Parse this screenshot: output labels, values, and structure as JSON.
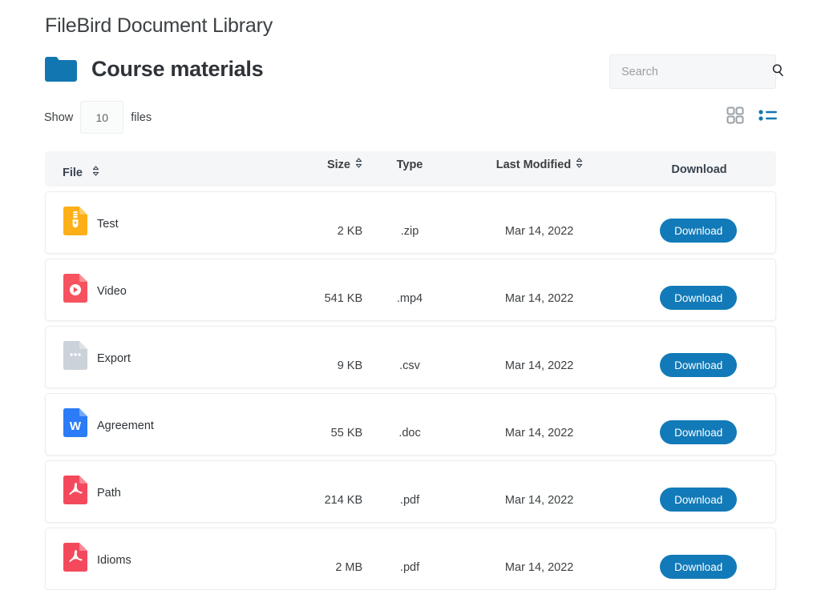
{
  "app": {
    "title": "FileBird Document Library"
  },
  "folder": {
    "icon": "folder-icon",
    "name": "Course materials",
    "color": "#1277b0"
  },
  "search": {
    "placeholder": "Search",
    "value": "",
    "icon": "search-icon"
  },
  "pagination": {
    "show_label": "Show",
    "per_page": "10",
    "files_label": "files"
  },
  "view_toggle": {
    "grid": {
      "icon": "grid-view-icon",
      "active": false,
      "color": "#9aa0a6"
    },
    "list": {
      "icon": "list-view-icon",
      "active": true,
      "color": "#1277b0"
    }
  },
  "table": {
    "columns": [
      {
        "key": "file",
        "label": "File",
        "sortable": true
      },
      {
        "key": "size",
        "label": "Size",
        "sortable": true
      },
      {
        "key": "type",
        "label": "Type",
        "sortable": false
      },
      {
        "key": "date",
        "label": "Last Modified",
        "sortable": true
      },
      {
        "key": "download",
        "label": "Download",
        "sortable": false
      }
    ],
    "rows": [
      {
        "name": "Test",
        "size": "2 KB",
        "type": ".zip",
        "date": "Mar 14, 2022",
        "download_label": "Download",
        "icon": "file-zip-icon",
        "icon_color": "#fcaf17"
      },
      {
        "name": "Video",
        "size": "541 KB",
        "type": ".mp4",
        "date": "Mar 14, 2022",
        "download_label": "Download",
        "icon": "file-video-icon",
        "icon_color": "#f7525f"
      },
      {
        "name": "Export",
        "size": "9 KB",
        "type": ".csv",
        "date": "Mar 14, 2022",
        "download_label": "Download",
        "icon": "file-csv-icon",
        "icon_color": "#cbd2d9"
      },
      {
        "name": "Agreement",
        "size": "55 KB",
        "type": ".doc",
        "date": "Mar 14, 2022",
        "download_label": "Download",
        "icon": "file-doc-icon",
        "icon_color": "#2b7cf6"
      },
      {
        "name": "Path",
        "size": "214 KB",
        "type": ".pdf",
        "date": "Mar 14, 2022",
        "download_label": "Download",
        "icon": "file-pdf-icon",
        "icon_color": "#f4495c"
      },
      {
        "name": "Idioms",
        "size": "2 MB",
        "type": ".pdf",
        "date": "Mar 14, 2022",
        "download_label": "Download",
        "icon": "file-pdf-icon",
        "icon_color": "#f4495c"
      }
    ]
  },
  "colors": {
    "accent": "#127ab8",
    "header_bg": "#f4f6f7",
    "text": "#3c4043"
  }
}
